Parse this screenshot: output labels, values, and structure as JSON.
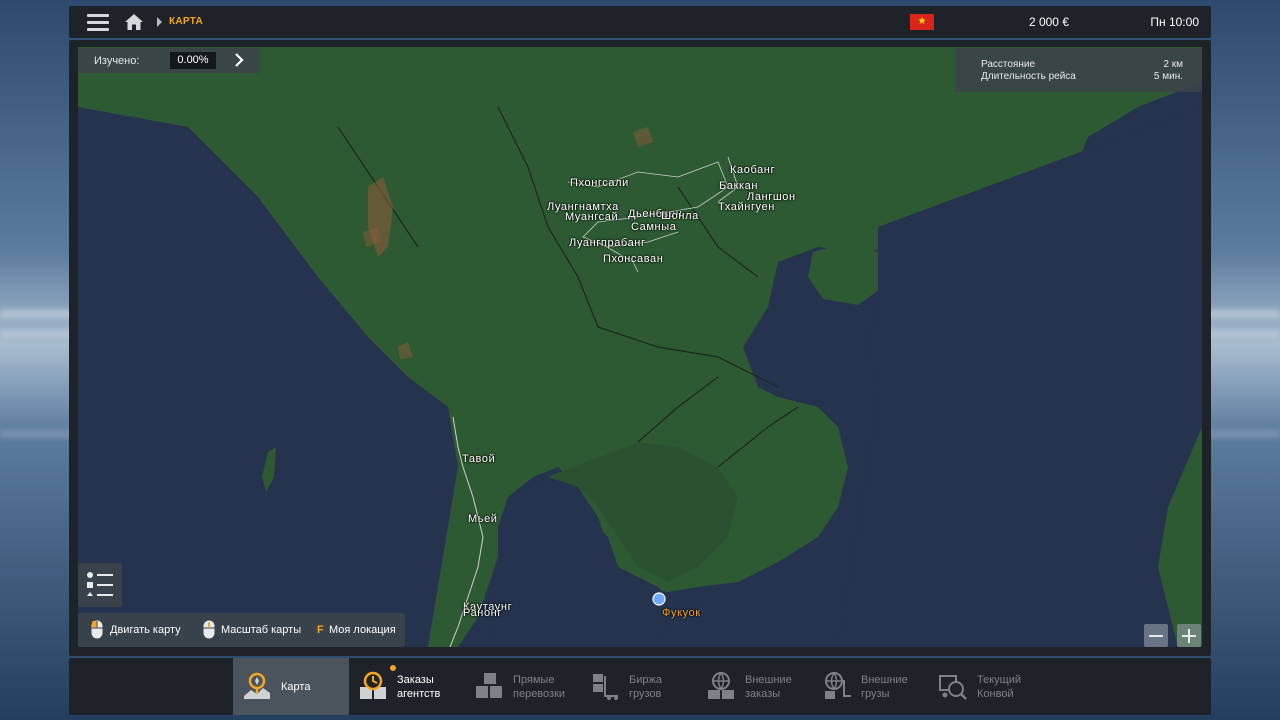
{
  "header": {
    "breadcrumb": "КАРТА",
    "money": "2 000 €",
    "clock": "Пн 10:00",
    "icons": [
      "menu-icon",
      "home-icon",
      "vietnam-flag-icon"
    ]
  },
  "studied": {
    "label": "Изучено:",
    "value": "0.00%"
  },
  "trip": {
    "distance_label": "Расстояние",
    "distance_value": "2 км",
    "duration_label": "Длительность рейса",
    "duration_value": "5 мин."
  },
  "controls": {
    "move_label": "Двигать карту",
    "zoom_label": "Масштаб карты",
    "location_key": "F",
    "location_label": "Моя локация"
  },
  "cities": {
    "kaobang": "Каобанг",
    "bakkan": "Баккан",
    "langshon": "Лангшон",
    "thaingyen": "Тхайнгуен",
    "phongsali": "Пхонгсали",
    "luangnamtha": "Луангнамтха",
    "muangsai": "Муангсай",
    "dienbien": "Дьенбьен",
    "shonla": "Шонла",
    "samnya": "Самныа",
    "luangprabang": "Луангпрабанг",
    "phonsavan": "Пхонсаван",
    "tavoy": "Тавой",
    "myei": "Мьей",
    "kawthaung": "Каутаунг",
    "ranong": "Ранонг",
    "phukuok": "Фукуок"
  },
  "bottom_tabs": [
    {
      "label": "Карта",
      "active": true,
      "icon": "map-pin-icon"
    },
    {
      "label": "Заказы агентств",
      "active": false,
      "icon": "clock-boxes-icon",
      "notification": true
    },
    {
      "label": "Прямые перевозки",
      "active": false,
      "icon": "boxes-icon",
      "disabled": true
    },
    {
      "label": "Биржа грузов",
      "active": false,
      "icon": "forklift-icon",
      "disabled": true
    },
    {
      "label": "Внешние заказы",
      "active": false,
      "icon": "globe-boxes-icon",
      "disabled": true
    },
    {
      "label": "Внешние грузы",
      "active": false,
      "icon": "globe-forklift-icon",
      "disabled": true
    },
    {
      "label": "Текущий Конвой",
      "active": false,
      "icon": "convoy-truck-icon",
      "disabled": true
    }
  ],
  "colors": {
    "accent": "#f5a623",
    "land": "#2e5a33",
    "sea": "#25334f",
    "panel": "#1e2329"
  }
}
